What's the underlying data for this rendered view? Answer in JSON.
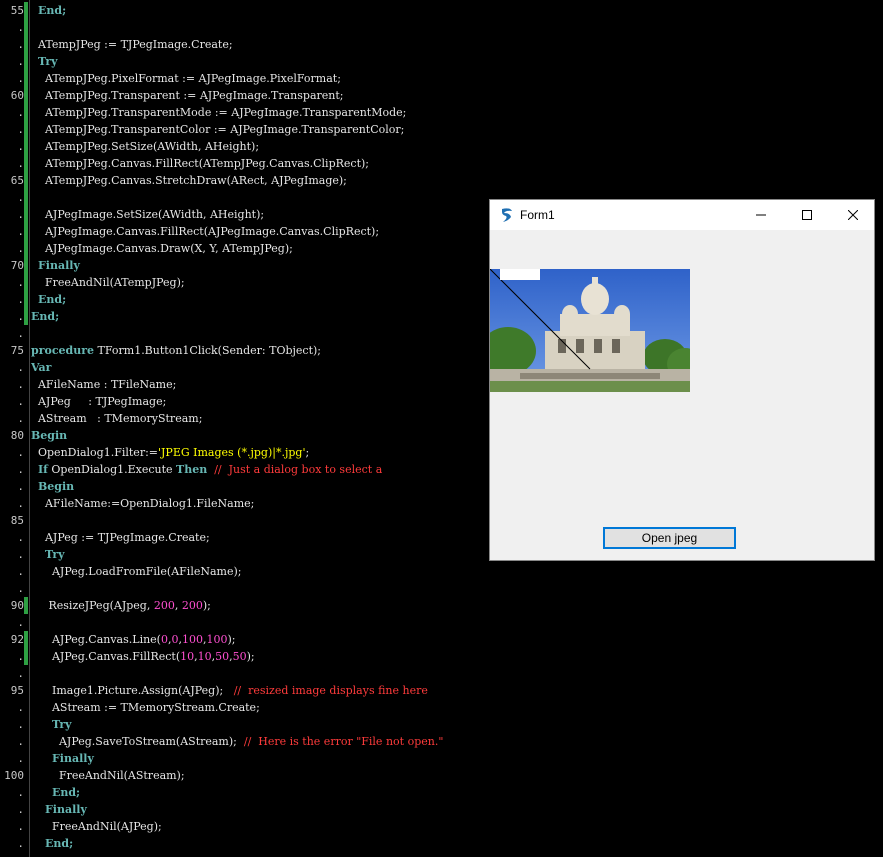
{
  "editor": {
    "accent_colors": {
      "keyword": "#67b7b4",
      "number": "#ff4fd1",
      "string": "#ffff00",
      "comment": "#ff3b3b",
      "text": "#e6e6e6",
      "modified_marker": "#2ea043"
    },
    "lines": [
      {
        "ln": "55",
        "mod": true,
        "tokens": [
          {
            "t": "  "
          },
          {
            "t": "End;",
            "c": "kw"
          }
        ]
      },
      {
        "ln": ".",
        "mod": true,
        "tokens": []
      },
      {
        "ln": ".",
        "mod": true,
        "tokens": [
          {
            "t": "  ATempJPeg := TJPegImage.Create;"
          }
        ]
      },
      {
        "ln": ".",
        "mod": true,
        "tokens": [
          {
            "t": "  "
          },
          {
            "t": "Try",
            "c": "kw"
          }
        ]
      },
      {
        "ln": ".",
        "mod": true,
        "tokens": [
          {
            "t": "    ATempJPeg.PixelFormat := AJPegImage.PixelFormat;"
          }
        ]
      },
      {
        "ln": "60",
        "mod": true,
        "tokens": [
          {
            "t": "    ATempJPeg.Transparent := AJPegImage.Transparent;"
          }
        ]
      },
      {
        "ln": ".",
        "mod": true,
        "tokens": [
          {
            "t": "    ATempJPeg.TransparentMode := AJPegImage.TransparentMode;"
          }
        ]
      },
      {
        "ln": ".",
        "mod": true,
        "tokens": [
          {
            "t": "    ATempJPeg.TransparentColor := AJPegImage.TransparentColor;"
          }
        ]
      },
      {
        "ln": ".",
        "mod": true,
        "tokens": [
          {
            "t": "    ATempJPeg.SetSize(AWidth, AHeight);"
          }
        ]
      },
      {
        "ln": ".",
        "mod": true,
        "tokens": [
          {
            "t": "    ATempJPeg.Canvas.FillRect(ATempJPeg.Canvas.ClipRect);"
          }
        ]
      },
      {
        "ln": "65",
        "mod": true,
        "tokens": [
          {
            "t": "    ATempJPeg.Canvas.StretchDraw(ARect, AJPegImage);"
          }
        ]
      },
      {
        "ln": ".",
        "mod": true,
        "tokens": []
      },
      {
        "ln": ".",
        "mod": true,
        "tokens": [
          {
            "t": "    AJPegImage.SetSize(AWidth, AHeight);"
          }
        ]
      },
      {
        "ln": ".",
        "mod": true,
        "tokens": [
          {
            "t": "    AJPegImage.Canvas.FillRect(AJPegImage.Canvas.ClipRect);"
          }
        ]
      },
      {
        "ln": ".",
        "mod": true,
        "tokens": [
          {
            "t": "    AJPegImage.Canvas.Draw(X, Y, ATempJPeg);"
          }
        ]
      },
      {
        "ln": "70",
        "mod": true,
        "tokens": [
          {
            "t": "  "
          },
          {
            "t": "Finally",
            "c": "kw"
          }
        ]
      },
      {
        "ln": ".",
        "mod": true,
        "tokens": [
          {
            "t": "    FreeAndNil(ATempJPeg);"
          }
        ]
      },
      {
        "ln": ".",
        "mod": true,
        "tokens": [
          {
            "t": "  "
          },
          {
            "t": "End;",
            "c": "kw"
          }
        ]
      },
      {
        "ln": ".",
        "mod": true,
        "tokens": [
          {
            "t": "End;",
            "c": "kw"
          }
        ]
      },
      {
        "ln": ".",
        "mod": false,
        "tokens": []
      },
      {
        "ln": "75",
        "mod": false,
        "tokens": [
          {
            "t": "procedure",
            "c": "kw"
          },
          {
            "t": " TForm1.Button1Click(Sender: TObject);"
          }
        ]
      },
      {
        "ln": ".",
        "mod": false,
        "tokens": [
          {
            "t": "Var",
            "c": "kw"
          }
        ]
      },
      {
        "ln": ".",
        "mod": false,
        "tokens": [
          {
            "t": "  AFileName : TFileName;"
          }
        ]
      },
      {
        "ln": ".",
        "mod": false,
        "tokens": [
          {
            "t": "  AJPeg     : TJPegImage;"
          }
        ]
      },
      {
        "ln": ".",
        "mod": false,
        "tokens": [
          {
            "t": "  AStream   : TMemoryStream;"
          }
        ]
      },
      {
        "ln": "80",
        "mod": false,
        "tokens": [
          {
            "t": "Begin",
            "c": "kw"
          }
        ]
      },
      {
        "ln": ".",
        "mod": false,
        "tokens": [
          {
            "t": "  OpenDialog1.Filter:="
          },
          {
            "t": "'JPEG Images (*.jpg)|*.jpg'",
            "c": "str"
          },
          {
            "t": ";"
          }
        ]
      },
      {
        "ln": ".",
        "mod": false,
        "tokens": [
          {
            "t": "  "
          },
          {
            "t": "If",
            "c": "kw"
          },
          {
            "t": " OpenDialog1.Execute "
          },
          {
            "t": "Then",
            "c": "kw"
          },
          {
            "t": "  "
          },
          {
            "t": "//  Just a dialog box to select a",
            "c": "cmt"
          }
        ]
      },
      {
        "ln": ".",
        "mod": false,
        "tokens": [
          {
            "t": "  "
          },
          {
            "t": "Begin",
            "c": "kw"
          }
        ]
      },
      {
        "ln": ".",
        "mod": false,
        "tokens": [
          {
            "t": "    AFileName:=OpenDialog1.FileName;"
          }
        ]
      },
      {
        "ln": "85",
        "mod": false,
        "tokens": []
      },
      {
        "ln": ".",
        "mod": false,
        "tokens": [
          {
            "t": "    AJPeg := TJPegImage.Create;"
          }
        ]
      },
      {
        "ln": ".",
        "mod": false,
        "tokens": [
          {
            "t": "    "
          },
          {
            "t": "Try",
            "c": "kw"
          }
        ]
      },
      {
        "ln": ".",
        "mod": false,
        "tokens": [
          {
            "t": "      AJPeg.LoadFromFile(AFileName);"
          }
        ]
      },
      {
        "ln": ".",
        "mod": false,
        "tokens": []
      },
      {
        "ln": "90",
        "mod": true,
        "tokens": [
          {
            "t": "     ResizeJPeg(AJpeg, "
          },
          {
            "t": "200",
            "c": "num"
          },
          {
            "t": ", "
          },
          {
            "t": "200",
            "c": "num"
          },
          {
            "t": ");"
          }
        ]
      },
      {
        "ln": ".",
        "mod": false,
        "tokens": []
      },
      {
        "ln": "92",
        "mod": true,
        "tokens": [
          {
            "t": "      AJPeg.Canvas.Line("
          },
          {
            "t": "0",
            "c": "num"
          },
          {
            "t": ","
          },
          {
            "t": "0",
            "c": "num"
          },
          {
            "t": ","
          },
          {
            "t": "100",
            "c": "num"
          },
          {
            "t": ","
          },
          {
            "t": "100",
            "c": "num"
          },
          {
            "t": ");"
          }
        ]
      },
      {
        "ln": ".",
        "mod": true,
        "tokens": [
          {
            "t": "      AJPeg.Canvas.FillRect("
          },
          {
            "t": "10",
            "c": "num"
          },
          {
            "t": ","
          },
          {
            "t": "10",
            "c": "num"
          },
          {
            "t": ","
          },
          {
            "t": "50",
            "c": "num"
          },
          {
            "t": ","
          },
          {
            "t": "50",
            "c": "num"
          },
          {
            "t": ");"
          }
        ]
      },
      {
        "ln": ".",
        "mod": false,
        "tokens": []
      },
      {
        "ln": "95",
        "mod": false,
        "tokens": [
          {
            "t": "      Image1.Picture.Assign(AJPeg);   "
          },
          {
            "t": "//  resized image displays fine here",
            "c": "cmt"
          }
        ]
      },
      {
        "ln": ".",
        "mod": false,
        "tokens": [
          {
            "t": "      AStream := TMemoryStream.Create;"
          }
        ]
      },
      {
        "ln": ".",
        "mod": false,
        "tokens": [
          {
            "t": "      "
          },
          {
            "t": "Try",
            "c": "kw"
          }
        ]
      },
      {
        "ln": ".",
        "mod": false,
        "tokens": [
          {
            "t": "        AJPeg.SaveToStream(AStream);  "
          },
          {
            "t": "//  Here is the error \"File not open.\"",
            "c": "cmt"
          }
        ]
      },
      {
        "ln": ".",
        "mod": false,
        "tokens": [
          {
            "t": "      "
          },
          {
            "t": "Finally",
            "c": "kw"
          }
        ]
      },
      {
        "ln": "100",
        "mod": false,
        "tokens": [
          {
            "t": "        FreeAndNil(AStream);"
          }
        ]
      },
      {
        "ln": ".",
        "mod": false,
        "tokens": [
          {
            "t": "      "
          },
          {
            "t": "End;",
            "c": "kw"
          }
        ]
      },
      {
        "ln": ".",
        "mod": false,
        "tokens": [
          {
            "t": "    "
          },
          {
            "t": "Finally",
            "c": "kw"
          }
        ]
      },
      {
        "ln": ".",
        "mod": false,
        "tokens": [
          {
            "t": "      FreeAndNil(AJPeg);"
          }
        ]
      },
      {
        "ln": ".",
        "mod": false,
        "tokens": [
          {
            "t": "    "
          },
          {
            "t": "End;",
            "c": "kw"
          }
        ]
      }
    ]
  },
  "form": {
    "title": "Form1",
    "app_icon": "lazarus-icon",
    "min_icon": "minimize-icon",
    "max_icon": "maximize-icon",
    "close_icon": "close-icon",
    "open_button_label": "Open jpeg",
    "image_description_icon": "photo-sacre-coeur"
  }
}
